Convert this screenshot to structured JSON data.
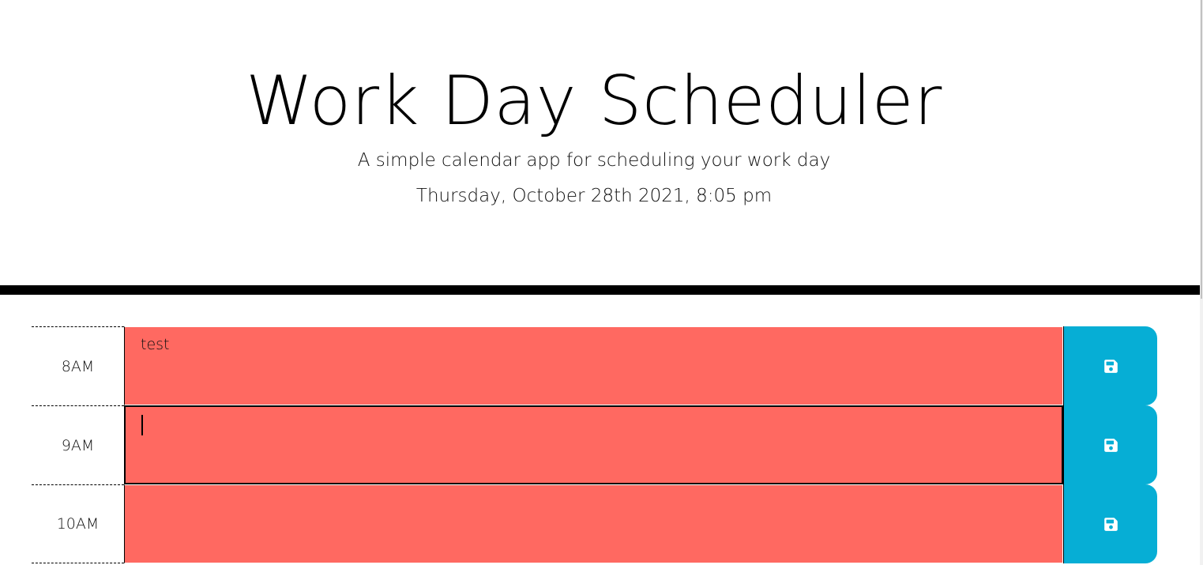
{
  "header": {
    "title": "Work Day Scheduler",
    "subtitle": "A simple calendar app for scheduling your work day",
    "current_day": "Thursday, October 28th 2021, 8:05 pm"
  },
  "colors": {
    "past": "#ff6961",
    "save_button": "#06aed5",
    "divider": "#000000"
  },
  "time_blocks": [
    {
      "hour": "8AM",
      "text": "test",
      "state": "past",
      "icon": "save-icon"
    },
    {
      "hour": "9AM",
      "text": "",
      "state": "past",
      "focused": true,
      "icon": "save-icon"
    },
    {
      "hour": "10AM",
      "text": "",
      "state": "past",
      "icon": "save-icon"
    }
  ]
}
